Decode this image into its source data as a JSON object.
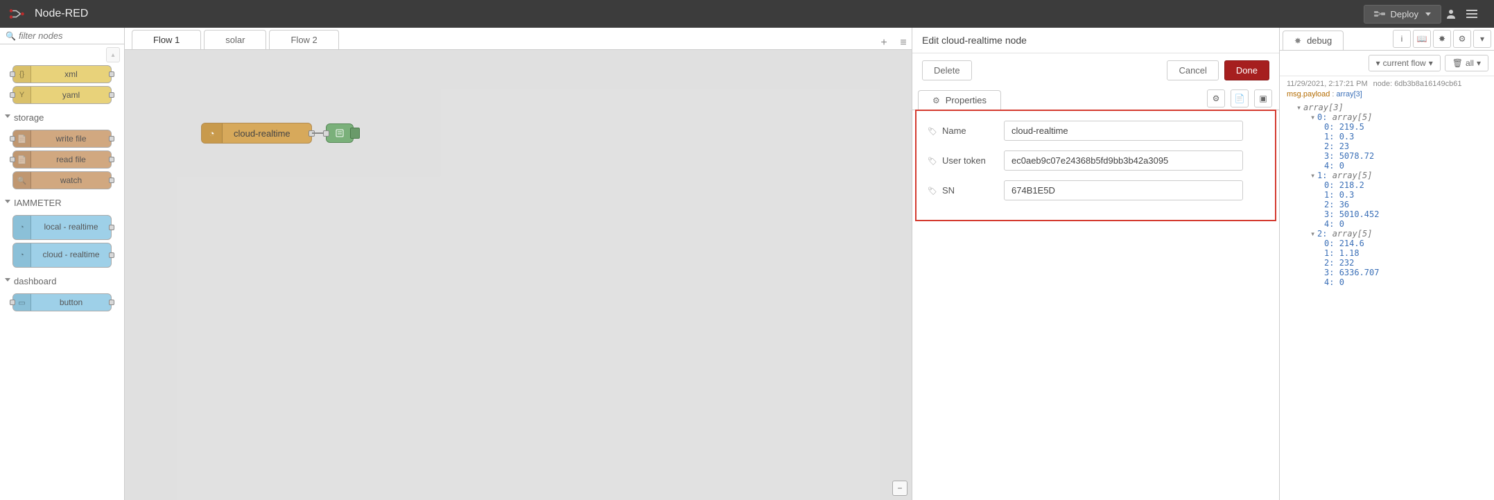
{
  "header": {
    "title": "Node-RED",
    "deploy_label": "Deploy"
  },
  "palette": {
    "filter_placeholder": "filter nodes",
    "nodes_top": [
      {
        "label": "xml",
        "cls": "node-yellow"
      },
      {
        "label": "yaml",
        "cls": "node-yellow"
      }
    ],
    "cat_storage": "storage",
    "nodes_storage": [
      {
        "label": "write file",
        "cls": "node-brown"
      },
      {
        "label": "read file",
        "cls": "node-brown"
      },
      {
        "label": "watch",
        "cls": "node-brown"
      }
    ],
    "cat_iammeter": "IAMMETER",
    "nodes_iammeter": [
      {
        "label": "local - realtime",
        "cls": "node-blue"
      },
      {
        "label": "cloud - realtime",
        "cls": "node-blue"
      }
    ],
    "cat_dashboard": "dashboard",
    "nodes_dashboard": [
      {
        "label": "button",
        "cls": "node-blue"
      }
    ]
  },
  "workspace": {
    "tabs": [
      {
        "label": "Flow 1",
        "active": true
      },
      {
        "label": "solar",
        "active": false
      },
      {
        "label": "Flow 2",
        "active": false
      }
    ],
    "flow_node_label": "cloud-realtime"
  },
  "edit": {
    "title": "Edit cloud-realtime node",
    "delete_label": "Delete",
    "cancel_label": "Cancel",
    "done_label": "Done",
    "tab_properties": "Properties",
    "fields": {
      "name_label": "Name",
      "name_value": "cloud-realtime",
      "token_label": "User token",
      "token_value": "ec0aeb9c07e24368b5fd9bb3b42a3095",
      "sn_label": "SN",
      "sn_value": "674B1E5D"
    }
  },
  "sidebar": {
    "tab_label": "debug",
    "filter_label": "current flow",
    "all_label": "all",
    "msg": {
      "time": "11/29/2021, 2:17:21 PM",
      "node": "node: 6db3b8a16149cb61",
      "payload_label": "msg.payload",
      "payload_type": "array[3]"
    },
    "root_label": "array[3]",
    "items": [
      {
        "idx": 0,
        "len": 5,
        "vals": [
          219.5,
          0.3,
          23,
          5078.72,
          0
        ]
      },
      {
        "idx": 1,
        "len": 5,
        "vals": [
          218.2,
          0.3,
          36,
          5010.452,
          0
        ]
      },
      {
        "idx": 2,
        "len": 5,
        "vals": [
          214.6,
          1.18,
          232,
          6336.707,
          0
        ]
      }
    ]
  }
}
